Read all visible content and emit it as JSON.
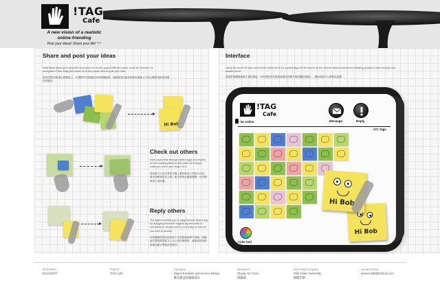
{
  "header": {
    "logo_tag": "!TAG",
    "logo_cafe": "Cafe",
    "tagline": "A new vision of a realistic online-friending",
    "tagline_sub": "Post your ideas! Share your life! ^-^"
  },
  "share": {
    "title": "Share and post your ideas",
    "body": "Write/draw down your idea with your hand on a note paper.Different colors could be choosen for recognition.Then drag your ideas on to the public area to post your note.",
    "body_cn": "將您的想法寫/畫在便條紙上，可選擇不同的顏色作為辨識使用，接著將您的留言拖曳至畫面上方的公開區域即完成發布的動作。"
  },
  "check": {
    "title": "Check out others",
    "body": "User could view through other's tags and replies on the sharing platform.Also,post will enlarge while you move your finger on it.",
    "body_cn": "使用者可以在分享的空間上看到其他人的貼文內容，將手指移到貼文上時，貼文會放大讓您閱讀，也可瀏覽他人的回應。"
  },
  "reply": {
    "title": "Reply others",
    "body": "The system allows you to reply/answer other's tag by dragging down the original tag and write in new ideas,or simply add on a new tag on the one you wish to answer.",
    "body_cn": "可將喜歡的貼文拖曳至下方的區域並寫下回應，或直接在想回應的貼文上加上新的便條紙，就能與其他使用者互動分享彼此的想法。"
  },
  "interface": {
    "title": "Interface",
    "body": "Using the local net-work and electric table,all of the posted tags will be shown on the electric table touchscreen,allowing people to view through and answer them.",
    "body_cn": "透過區域網路與電子桌的連結，所有張貼的訊息將被傳送到電子桌的觸控螢幕上，讓使用者可以瀏覽及回應。"
  },
  "screen": {
    "logo_tag": "!TAG",
    "logo_cafe": "Cafe",
    "online": "51 online",
    "message_label": "Message",
    "reply_label": "Reply",
    "tags_count": "271 Tags",
    "color_tool": "Color tool",
    "note_text": "Hi Bob"
  },
  "scenes": {
    "note_text": "Hi Bob"
  },
  "footer": [
    {
      "key": "ID Number",
      "value": "B11044077"
    },
    {
      "key": "Project",
      "value": "!TAG café"
    },
    {
      "key": "Category",
      "value": "Digital Products and Service Design",
      "value2": "數位產品與服務設計"
    },
    {
      "key": "Designers",
      "value": "Chang Yen Chen",
      "value2": "張晏誠"
    },
    {
      "key": "University/company",
      "value": "Shih Chien University",
      "value2": "實踐大學"
    },
    {
      "key": "contact email",
      "value": "peace1438@hotmail.com"
    }
  ],
  "colors": {
    "note_yellow": "#f6e35c",
    "note_blue": "#4f7fd0",
    "note_green": "#8cc04b",
    "device_black": "#1b1b1b"
  }
}
